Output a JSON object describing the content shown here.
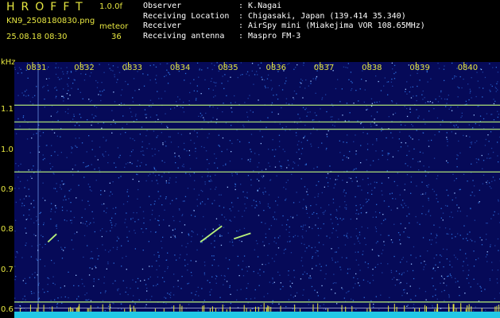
{
  "header": {
    "brand": "HROFFT",
    "version": "1.0.0f",
    "filename": "KN9_2508180830.png",
    "meteor_label": "meteor",
    "timestamp": "25.08.18 08:30",
    "meteor_count": "36"
  },
  "station": [
    {
      "key": "Observer",
      "value": ": K.Nagai"
    },
    {
      "key": "Receiving Location",
      "value": ": Chigasaki, Japan (139.414 35.340)"
    },
    {
      "key": "Receiver",
      "value": ": AirSpy mini (Miakejima VOR 108.65MHz)"
    },
    {
      "key": "Receiving antenna",
      "value": ": Maspro FM-3"
    }
  ],
  "chart_data": {
    "type": "heatmap",
    "title": "",
    "ylabel": "kHz",
    "ylim": [
      0.58,
      1.22
    ],
    "xlim": [
      0,
      10
    ],
    "x_ticks": [
      "0831",
      "0832",
      "0833",
      "0834",
      "0835",
      "0836",
      "0837",
      "0838",
      "0839",
      "0840"
    ],
    "y_ticks": [
      0.6,
      0.7,
      0.8,
      0.9,
      1.0,
      1.1
    ],
    "colors": {
      "background": "#060a58",
      "noise": "#2b6bd6",
      "signal": "#b8f07a",
      "axis": "#e6e640",
      "baseline": "#21c8e6"
    },
    "carriers_khz": [
      1.112,
      1.07,
      1.052,
      0.945,
      0.62
    ],
    "meteor_trails": [
      {
        "x": [
          0.32,
          0.5
        ],
        "y": [
          0.77,
          0.79
        ]
      },
      {
        "x": [
          3.5,
          3.95
        ],
        "y": [
          0.77,
          0.81
        ]
      },
      {
        "x": [
          4.2,
          4.55
        ],
        "y": [
          0.778,
          0.792
        ]
      }
    ]
  }
}
